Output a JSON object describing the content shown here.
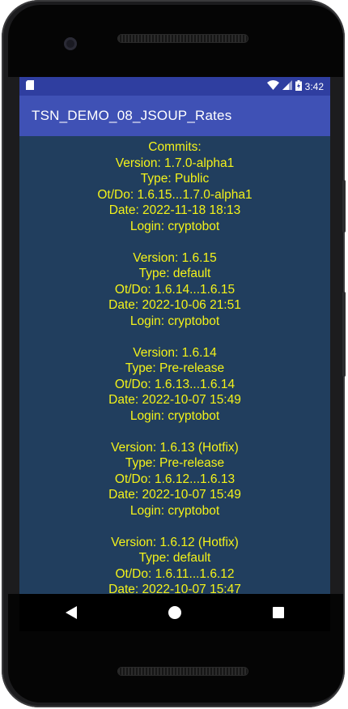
{
  "statusbar": {
    "time": "3:42"
  },
  "appbar": {
    "title": "TSN_DEMO_08_JSOUP_Rates"
  },
  "content": {
    "heading": "Commits:",
    "entries": [
      {
        "version": "Version: 1.7.0-alpha1",
        "type": "Type: Public",
        "range": "Ot/Do: 1.6.15...1.7.0-alpha1",
        "date": "Date: 2022-11-18 18:13",
        "login": "Login: cryptobot"
      },
      {
        "version": "Version: 1.6.15",
        "type": "Type: default",
        "range": "Ot/Do: 1.6.14...1.6.15",
        "date": "Date: 2022-10-06 21:51",
        "login": "Login: cryptobot"
      },
      {
        "version": "Version: 1.6.14",
        "type": "Type: Pre-release",
        "range": "Ot/Do: 1.6.13...1.6.14",
        "date": "Date: 2022-10-07 15:49",
        "login": "Login: cryptobot"
      },
      {
        "version": "Version: 1.6.13 (Hotfix)",
        "type": "Type: Pre-release",
        "range": "Ot/Do: 1.6.12...1.6.13",
        "date": "Date: 2022-10-07 15:49",
        "login": "Login: cryptobot"
      },
      {
        "version": "Version: 1.6.12 (Hotfix)",
        "type": "Type: default",
        "range": "Ot/Do: 1.6.11...1.6.12",
        "date": "Date: 2022-10-07 15:47",
        "login": ""
      }
    ]
  },
  "navbar": {
    "icons": [
      "back-icon",
      "home-icon",
      "recents-icon"
    ]
  },
  "colors": {
    "statusbar": "#2f3ea0",
    "appbar": "#3f51b5",
    "content_background": "#213e5e",
    "content_text": "#f3f21a"
  }
}
